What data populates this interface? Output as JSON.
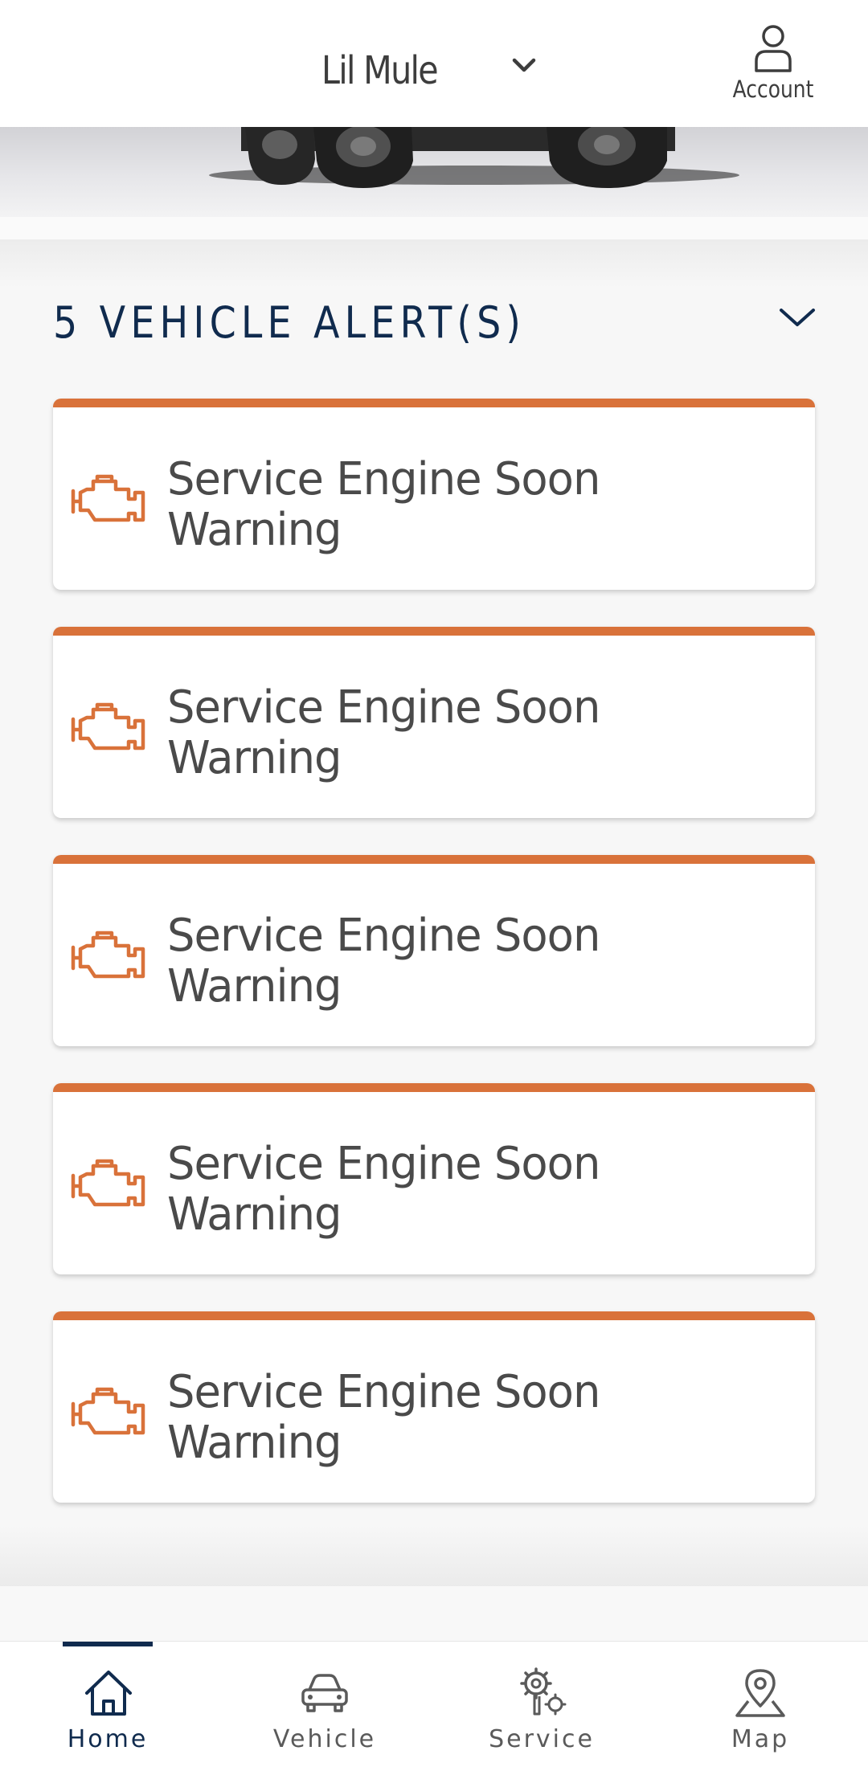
{
  "header": {
    "vehicle_name": "Lil Mule",
    "vehicle_chevron_icon": "chevron-down-icon",
    "account_label": "Account",
    "account_icon": "user-icon"
  },
  "hero": {
    "image": "truck-wheels-image"
  },
  "alerts": {
    "title": "5 VEHICLE ALERT(S)",
    "collapse_icon": "chevron-down-icon",
    "accent_color": "#d9723a",
    "items": [
      {
        "icon": "engine-icon",
        "label": "Service Engine Soon Warning"
      },
      {
        "icon": "engine-icon",
        "label": "Service Engine Soon Warning"
      },
      {
        "icon": "engine-icon",
        "label": "Service Engine Soon Warning"
      },
      {
        "icon": "engine-icon",
        "label": "Service Engine Soon Warning"
      },
      {
        "icon": "engine-icon",
        "label": "Service Engine Soon Warning"
      }
    ]
  },
  "bottom_nav": {
    "active_color": "#102b4e",
    "items": [
      {
        "label": "Home",
        "icon": "home-icon",
        "active": true
      },
      {
        "label": "Vehicle",
        "icon": "car-icon",
        "active": false
      },
      {
        "label": "Service",
        "icon": "service-gears-icon",
        "active": false
      },
      {
        "label": "Map",
        "icon": "map-pin-icon",
        "active": false
      }
    ]
  }
}
